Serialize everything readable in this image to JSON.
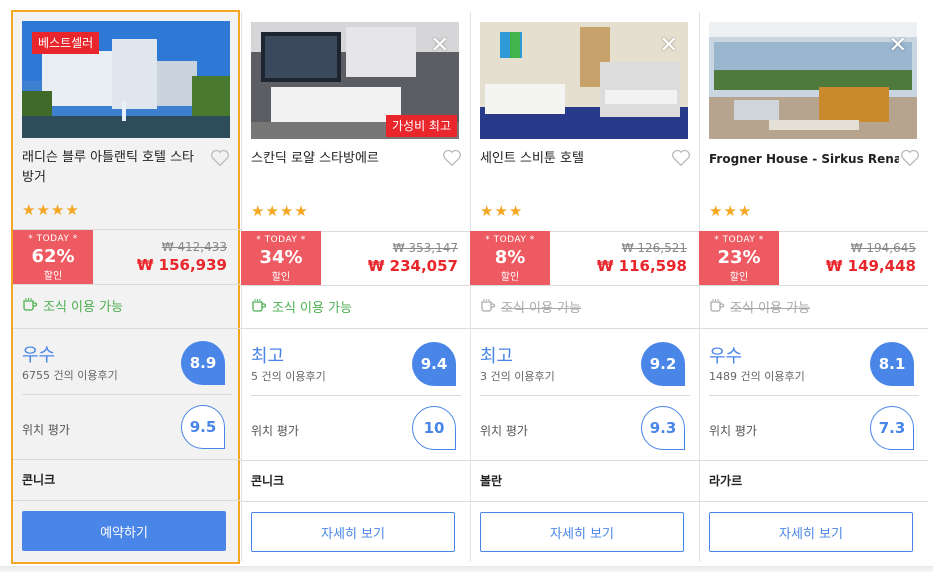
{
  "hotels": [
    {
      "name": "래디슨 블루 아틀랜틱 호텔 스타방거",
      "badge": "베스트셀러",
      "stars": "★★★★",
      "star_count": 4,
      "today_label": "* TODAY *",
      "discount": "62%",
      "discount_unit": "할인",
      "price_old": "₩ 412,433",
      "price_new": "₩ 156,939",
      "breakfast": "조식 이용 가능",
      "breakfast_available": true,
      "rating_word": "우수",
      "reviews": "6755 건의 이용후기",
      "score": "8.9",
      "location_label": "위치 평가",
      "location_score": "9.5",
      "area": "콘니크",
      "button": "예약하기"
    },
    {
      "name": "스칸딕 로얄 스타방에르",
      "badge": "가성비 최고",
      "stars": "★★★★",
      "star_count": 4,
      "today_label": "* TODAY *",
      "discount": "34%",
      "discount_unit": "할인",
      "price_old": "₩ 353,147",
      "price_new": "₩ 234,057",
      "breakfast": "조식 이용 가능",
      "breakfast_available": true,
      "rating_word": "최고",
      "reviews": "5 건의 이용후기",
      "score": "9.4",
      "location_label": "위치 평가",
      "location_score": "10",
      "area": "콘니크",
      "button": "자세히 보기"
    },
    {
      "name": "세인트 스비툰 호텔",
      "stars": "★★★",
      "star_count": 3,
      "today_label": "* TODAY *",
      "discount": "8%",
      "discount_unit": "할인",
      "price_old": "₩ 126,521",
      "price_new": "₩ 116,598",
      "breakfast": "조식 이용 가능",
      "breakfast_available": false,
      "rating_word": "최고",
      "reviews": "3 건의 이용후기",
      "score": "9.2",
      "location_label": "위치 평가",
      "location_score": "9.3",
      "area": "볼란",
      "button": "자세히 보기"
    },
    {
      "name": "Frogner House - Sirkus Renaa",
      "stars": "★★★",
      "star_count": 3,
      "today_label": "* TODAY *",
      "discount": "23%",
      "discount_unit": "할인",
      "price_old": "₩ 194,645",
      "price_new": "₩ 149,448",
      "breakfast": "조식 이용 가능",
      "breakfast_available": false,
      "rating_word": "우수",
      "reviews": "1489 건의 이용후기",
      "score": "8.1",
      "location_label": "위치 평가",
      "location_score": "7.3",
      "area": "라가르",
      "button": "자세히 보기"
    }
  ],
  "icons": {
    "close": "close-icon",
    "heart": "heart-icon",
    "breakfast": "coffee-cup-icon"
  },
  "colors": {
    "accent_blue": "#4a86e8",
    "sale_red": "#ee5a61",
    "price_red": "#e8262b",
    "star_orange": "#f5a623",
    "breakfast_green": "#4caf50",
    "selected_border": "#f5a623"
  }
}
